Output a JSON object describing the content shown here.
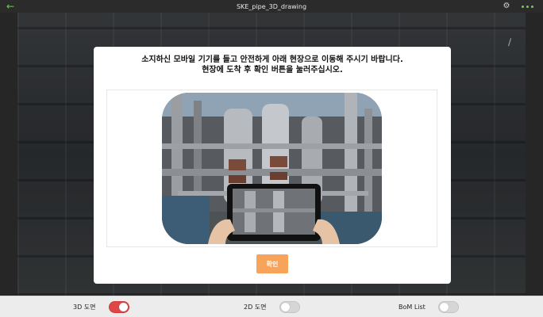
{
  "titlebar": {
    "title": "SKE_pipe_3D_drawing",
    "back_icon": "arrow-left-icon",
    "settings_icon": "gear-icon",
    "more_icon": "more-dots-icon",
    "accent_color": "#6fcf50"
  },
  "modal": {
    "message_line1": "소지하신 모바일 기기를 들고 안전하게 아래 현장으로 이동해 주시기 바랍니다.",
    "message_line2": "현장에 도착 후 확인 버튼을 눌러주십시오.",
    "confirm_label": "확인",
    "confirm_color": "#f7a45a"
  },
  "toolbar": {
    "toggles": [
      {
        "label": "3D 도면",
        "on": true
      },
      {
        "label": "2D 도면",
        "on": false
      },
      {
        "label": "BoM List",
        "on": false
      }
    ],
    "on_color": "#e04646"
  }
}
